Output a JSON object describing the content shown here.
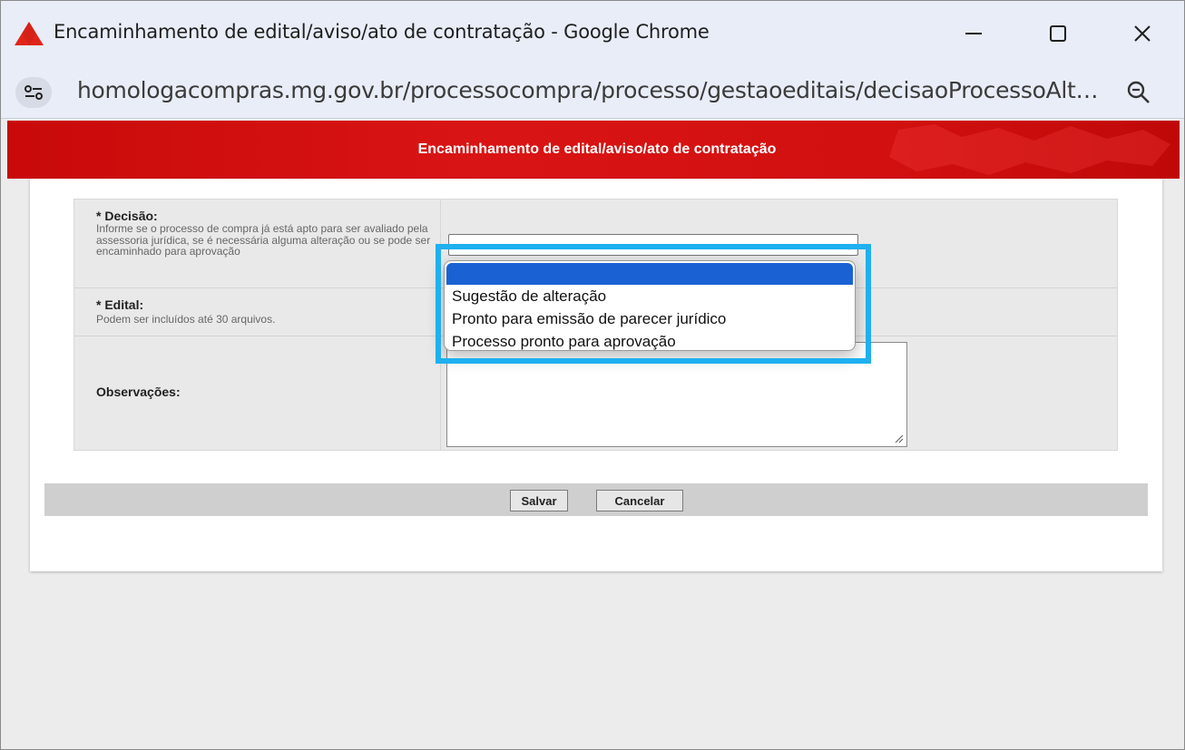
{
  "window": {
    "title": "Encaminhamento de edital/aviso/ato de contratação - Google Chrome",
    "url": "homologacompras.mg.gov.br/processocompra/processo/gestaoeditais/decisaoProcessoAlt…"
  },
  "icons": {
    "logo": "red-triangle-logo",
    "site_info": "tune-icon",
    "zoom": "zoom-out-icon",
    "minimize": "minimize-icon",
    "maximize": "maximize-icon",
    "close": "close-icon"
  },
  "colors": {
    "banner_red": "#d21010",
    "highlight_blue": "#1fb0f0",
    "selected_option": "#1a62d4"
  },
  "page": {
    "banner_title": "Encaminhamento de edital/aviso/ato de contratação"
  },
  "form": {
    "decisao": {
      "label": "* Decisão:",
      "help": "Informe se o processo de compra já está apto para ser avaliado pela assessoria jurídica, se é necessária alguma alteração ou se pode ser encaminhado para aprovação",
      "selected_value": ""
    },
    "edital": {
      "label": "* Edital:",
      "help": "Podem ser incluídos até 30 arquivos."
    },
    "observacoes": {
      "label": "Observações:",
      "value": ""
    }
  },
  "dropdown": {
    "options": [
      "",
      "Sugestão de alteração",
      "Pronto para emissão de parecer jurídico",
      "Processo pronto para aprovação"
    ]
  },
  "buttons": {
    "save": "Salvar",
    "cancel": "Cancelar"
  }
}
